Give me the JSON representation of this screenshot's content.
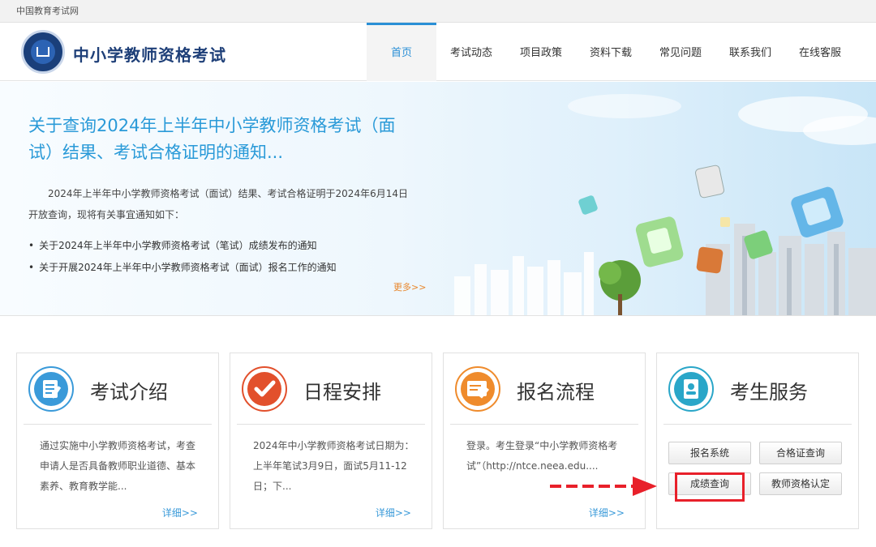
{
  "topbar": {
    "site_name": "中国教育考试网"
  },
  "header": {
    "title": "中小学教师资格考试"
  },
  "nav": [
    {
      "label": "首页",
      "active": true
    },
    {
      "label": "考试动态",
      "active": false
    },
    {
      "label": "项目政策",
      "active": false
    },
    {
      "label": "资料下载",
      "active": false
    },
    {
      "label": "常见问题",
      "active": false
    },
    {
      "label": "联系我们",
      "active": false
    },
    {
      "label": "在线客服",
      "active": false
    }
  ],
  "hero": {
    "title": "关于查询2024年上半年中小学教师资格考试（面试）结果、考试合格证明的通知...",
    "paragraph": "2024年上半年中小学教师资格考试（面试）结果、考试合格证明于2024年6月14日开放查询，现将有关事宜通知如下：",
    "links": [
      "关于2024年上半年中小学教师资格考试（笔试）成绩发布的通知",
      "关于开展2024年上半年中小学教师资格考试（面试）报名工作的通知"
    ],
    "more": "更多>>"
  },
  "cards": [
    {
      "title": "考试介绍",
      "icon": "document-pen-icon",
      "desc": "通过实施中小学教师资格考试，考查申请人是否具备教师职业道德、基本素养、教育教学能...",
      "more": "详细>>"
    },
    {
      "title": "日程安排",
      "icon": "checkmark-icon",
      "desc": "2024年中小学教师资格考试日期为：上半年笔试3月9日，面试5月11-12日；下...",
      "more": "详细>>"
    },
    {
      "title": "报名流程",
      "icon": "form-edit-icon",
      "desc": "登录。考生登录“中小学教师资格考试”（http://ntce.neea.edu....",
      "more": "详细>>"
    },
    {
      "title": "考生服务",
      "icon": "id-card-icon"
    }
  ],
  "services": {
    "register": "报名系统",
    "certificate_query": "合格证查询",
    "score_query": "成绩查询",
    "teacher_cert": "教师资格认定"
  },
  "colors": {
    "accent": "#2a9ad8",
    "highlight": "#e8202a",
    "more": "#e8862b"
  }
}
